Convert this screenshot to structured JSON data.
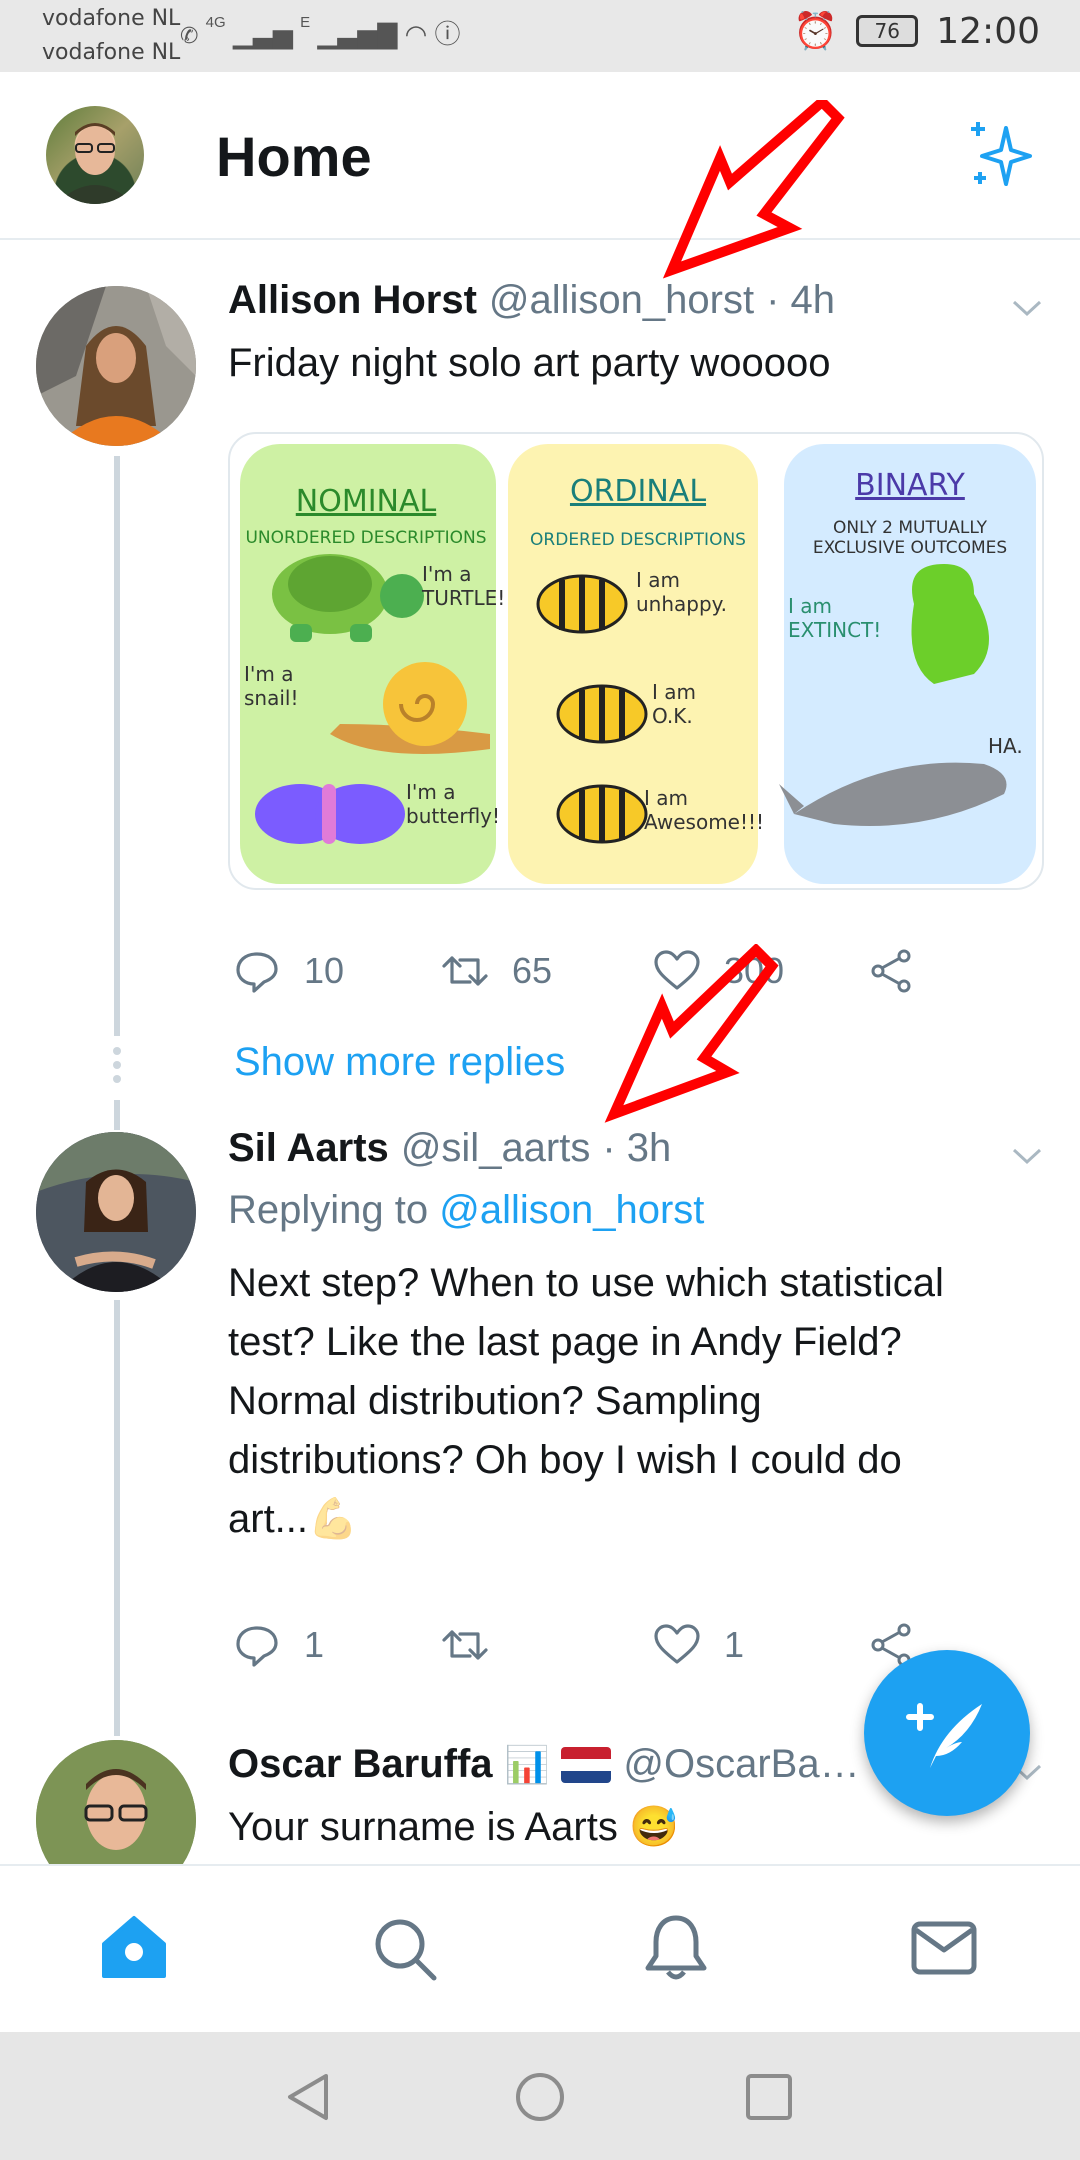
{
  "status_bar": {
    "carrier_1": "vodafone NL",
    "carrier_2": "vodafone NL",
    "net_1": "4G",
    "net_2": "E",
    "battery": "76",
    "time": "12:00"
  },
  "header": {
    "title": "Home"
  },
  "tweets": [
    {
      "name": "Allison Horst",
      "handle": "@allison_horst",
      "time": "· 4h",
      "text": "Friday night solo art party wooooo",
      "replies": "10",
      "retweets": "65",
      "likes": "300",
      "media": {
        "nominal": {
          "title": "NOMINAL",
          "sub": "UNORDERED DESCRIPTIONS",
          "turtle": "I'm a TURTLE!",
          "snail": "I'm a snail!",
          "butterfly": "I'm a butterfly!"
        },
        "ordinal": {
          "title": "ORDINAL",
          "sub": "ORDERED DESCRIPTIONS",
          "bee1": "I am unhappy.",
          "bee2": "I am O.K.",
          "bee3": "I am Awesome!!!"
        },
        "binary": {
          "title": "BINARY",
          "sub": "ONLY 2 MUTUALLY EXCLUSIVE OUTCOMES",
          "dino": "I am EXTINCT!",
          "shark": "HA."
        }
      }
    },
    {
      "name": "Sil Aarts",
      "handle": "@sil_aarts",
      "time": "· 3h",
      "reply_prefix": "Replying to ",
      "reply_to": "@allison_horst",
      "text_lines": [
        "Next step? When to use which statistical",
        "test? Like the last page in Andy Field?",
        "Normal distribution? Sampling",
        "distributions? Oh boy I wish I could do",
        "art..."
      ],
      "emoji": "💪",
      "replies": "1",
      "likes": "1"
    },
    {
      "name": "Oscar Baruffa",
      "name_emoji": "📊",
      "handle": "@OscarBa…",
      "text": "Your surname is Aarts",
      "emoji": "😅"
    }
  ],
  "show_more": "Show more replies",
  "colors": {
    "accent": "#1da1f2",
    "arrow": "#ff0000",
    "muted": "#657786"
  },
  "icons": [
    "reply-icon",
    "retweet-icon",
    "like-icon",
    "share-icon",
    "home-icon",
    "search-icon",
    "bell-icon",
    "mail-icon",
    "sparkle-icon",
    "compose-icon"
  ]
}
